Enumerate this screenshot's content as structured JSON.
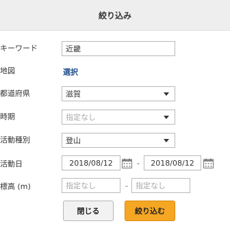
{
  "header": {
    "title": "絞り込み"
  },
  "filters": {
    "keyword": {
      "label": "キーワード",
      "value": "近畿"
    },
    "map": {
      "label": "地図",
      "link": "選択"
    },
    "prefecture": {
      "label": "都道府県",
      "value": "滋賀"
    },
    "period": {
      "label": "時期",
      "placeholder": "指定なし"
    },
    "activity_type": {
      "label": "活動種別",
      "value": "登山"
    },
    "activity_date": {
      "label": "活動日",
      "from": "2018/08/12",
      "separator": "-",
      "to": "2018/08/12"
    },
    "elevation": {
      "label": "標高 (m)",
      "min_placeholder": "指定なし",
      "separator": "-",
      "max_placeholder": "指定なし"
    }
  },
  "buttons": {
    "close": "閉じる",
    "apply": "絞り込む"
  },
  "colors": {
    "header_bg": "#eeeeee",
    "link": "#1f4e8c",
    "apply_button": "#f5a623"
  },
  "icons": [
    "chevron-down-icon",
    "calendar-icon"
  ]
}
